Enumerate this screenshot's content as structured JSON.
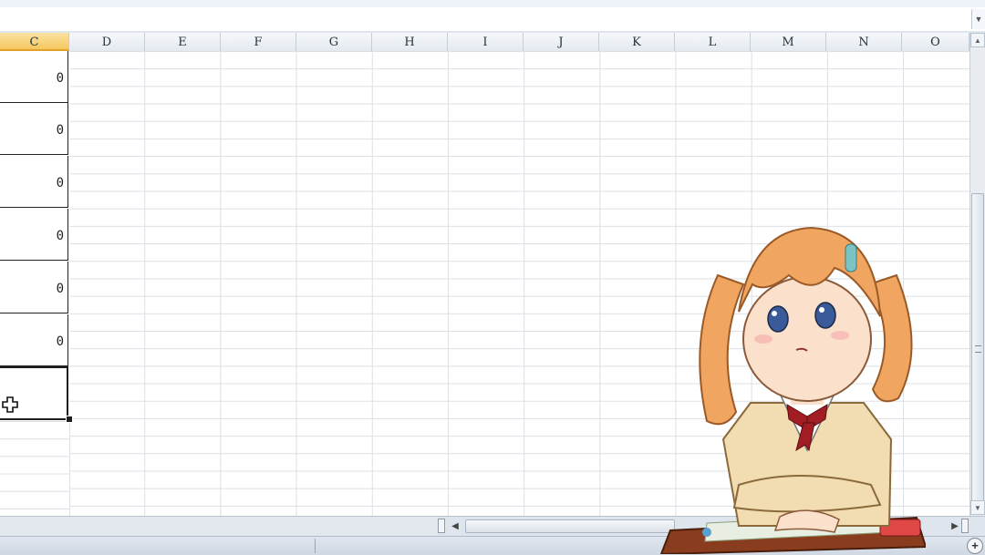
{
  "formula_bar": {
    "dropdown_icon": "chevron-down-icon"
  },
  "columns": [
    {
      "label": "C",
      "active": true
    },
    {
      "label": "D"
    },
    {
      "label": "E"
    },
    {
      "label": "F"
    },
    {
      "label": "G"
    },
    {
      "label": "H"
    },
    {
      "label": "I"
    },
    {
      "label": "J"
    },
    {
      "label": "K"
    },
    {
      "label": "L"
    },
    {
      "label": "M"
    },
    {
      "label": "N"
    },
    {
      "label": "O"
    }
  ],
  "column_c_values": [
    "0",
    "0",
    "0",
    "0",
    "0",
    "0",
    ""
  ],
  "selected_cell_index": 6,
  "cursor_icon": "cell-select-cross-icon",
  "scrollbars": {
    "up_icon": "arrow-up-icon",
    "down_icon": "arrow-down-icon",
    "left_icon": "arrow-left-icon",
    "right_icon": "arrow-right-icon"
  },
  "status_bar": {
    "zoom_icon": "zoom-in-icon"
  },
  "colors": {
    "active_header": "#f5c75d",
    "gridline": "#dcdfe4",
    "cell_border": "#222222",
    "chrome": "#dfe5ec"
  },
  "overlay": {
    "name": "anime-mascot-character"
  }
}
